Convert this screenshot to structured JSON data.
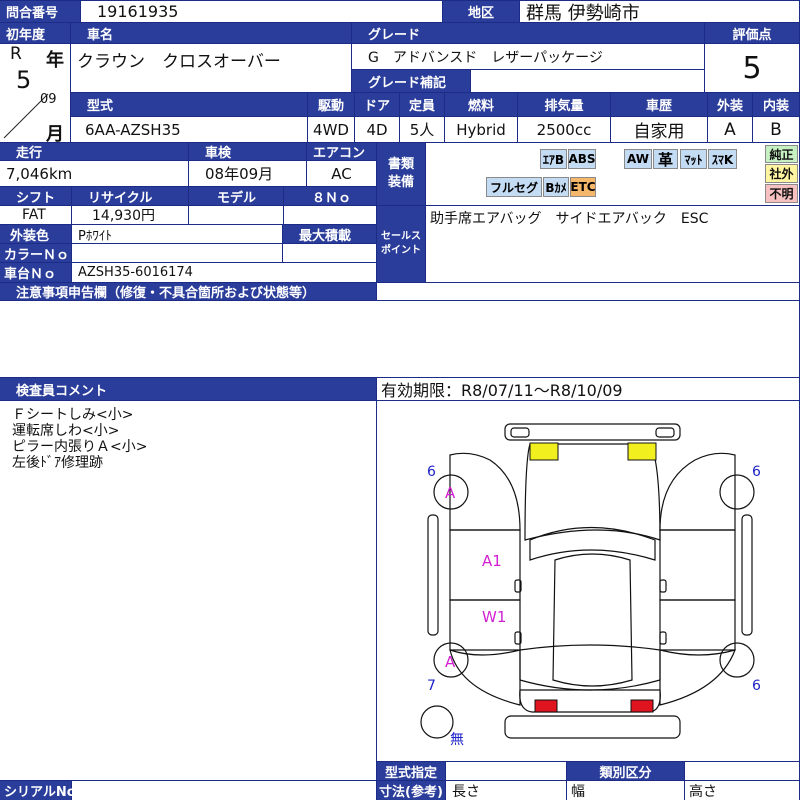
{
  "header": {
    "inquiry_label": "問合番号",
    "inquiry_no": "19161935",
    "region_label": "地区",
    "region": "群馬 伊勢崎市"
  },
  "row1": {
    "year_label": "初年度",
    "era": "R",
    "year_word": "年",
    "year_num": "5",
    "month_val": "09",
    "month_word": "月",
    "car_name_label": "車名",
    "car_name": "クラウン　クロスオーバー",
    "grade_label": "グレード",
    "grade": "G　アドバンスド　レザーパッケージ",
    "grade_sub_label": "グレード補記",
    "grade_sub": "",
    "score_label": "評価点",
    "score": "5"
  },
  "spec": {
    "model_label": "型式",
    "model": "6AA-AZSH35",
    "drive_label": "駆動",
    "drive": "4WD",
    "door_label": "ドア",
    "door": "4D",
    "seats_label": "定員",
    "seats": "5人",
    "fuel_label": "燃料",
    "fuel": "Hybrid",
    "disp_label": "排気量",
    "disp": "2500cc",
    "history_label": "車歴",
    "history": "自家用",
    "ext_label": "外装",
    "ext": "A",
    "int_label": "内装",
    "int": "B"
  },
  "run": {
    "mileage_label": "走行",
    "mileage": "7,046km",
    "inspection_label": "車検",
    "inspection": "08年09月",
    "ac_label": "エアコン",
    "ac": "AC",
    "shift_label": "シフト",
    "shift": "FAT",
    "recycle_label": "リサイクル",
    "recycle": "14,930円",
    "model_label": "モデル",
    "model_val": "",
    "no_label": "８Ｎｏ",
    "no_val": "",
    "color_label": "外装色",
    "color": "Pﾎﾜｲﾄ",
    "maxload_label": "最大積載",
    "maxload": "",
    "colorno_label": "カラーＮｏ",
    "colorno": "",
    "chassis_label": "車台Ｎｏ",
    "chassis": "AZSH35-6016174"
  },
  "equipment": {
    "label": "書類\n装備",
    "items_row1": [
      "ｴｱB",
      "ABS",
      "AW",
      "革",
      "ﾏｯﾄ",
      "ｽﾏK"
    ],
    "items_row2": [
      "フルセグ",
      "Bｶﾒ",
      "ETC"
    ],
    "status": [
      "純正",
      "社外",
      "不明"
    ]
  },
  "sales": {
    "label": "セールス\nポイント",
    "text": "助手席エアバッグ　サイドエアバック　ESC"
  },
  "notes": {
    "label": "注意事項申告欄（修復・不具合箇所および状態等）",
    "text": ""
  },
  "inspector": {
    "label": "検査員コメント",
    "comments": [
      "Ｆシートしみ<小>",
      "運転席しわ<小>",
      "ピラー内張りＡ<小>",
      "左後ﾄﾞｱ修理跡"
    ]
  },
  "validity": "有効期限：R8/07/11～R8/10/09",
  "diagram": {
    "tire_fl": "6",
    "tire_fr": "6",
    "tire_rl": "7",
    "tire_rr": "6",
    "mark_fl": "A",
    "mark_rl": "A",
    "mark_a1": "A1",
    "mark_w1": "W1",
    "spare": "無"
  },
  "footer": {
    "serial_label": "シリアルNo",
    "serial": "",
    "type_label": "型式指定",
    "type_val": "",
    "class_label": "類別区分",
    "class_val": "",
    "dims_label": "寸法(参考)",
    "length_label": "長さ",
    "width_label": "幅",
    "height_label": "高さ"
  },
  "colors": {
    "header_blue": "#2b3d9a",
    "equip_on": "#c4dbf4",
    "etc_orange": "#f5b76a",
    "mark_magenta": "#d21fd2",
    "tire_blue": "#1d23c8",
    "light_yellow": "#f1ef1e",
    "light_red": "#e0141e"
  }
}
